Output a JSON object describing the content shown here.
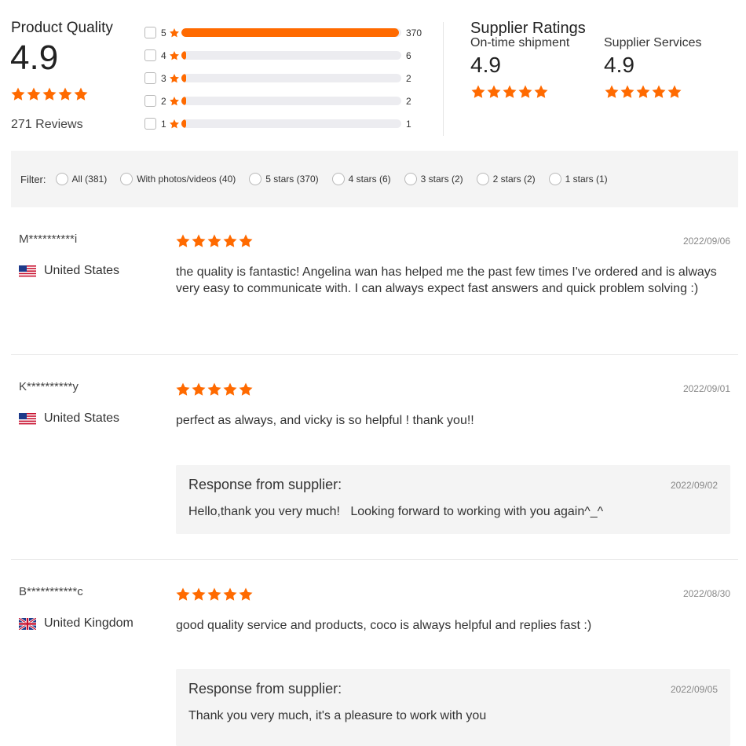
{
  "product_quality": {
    "title": "Product Quality",
    "score": "4.9",
    "stars": 5,
    "reviews_label": "271 Reviews"
  },
  "distribution": [
    {
      "stars": "5",
      "count": "370",
      "fill": 0.99
    },
    {
      "stars": "4",
      "count": "6",
      "fill": 0.02
    },
    {
      "stars": "3",
      "count": "2",
      "fill": 0.01
    },
    {
      "stars": "2",
      "count": "2",
      "fill": 0.01
    },
    {
      "stars": "1",
      "count": "1",
      "fill": 0.01
    }
  ],
  "supplier_ratings": {
    "title": "Supplier Ratings",
    "items": [
      {
        "label": "On-time shipment",
        "score": "4.9",
        "stars": 5
      },
      {
        "label": "Supplier Services",
        "score": "4.9",
        "stars": 5
      }
    ]
  },
  "filter": {
    "label": "Filter:",
    "options": [
      "All (381)",
      "With photos/videos (40)",
      "5 stars (370)",
      "4 stars (6)",
      "3 stars (2)",
      "2 stars (2)",
      "1 stars (1)"
    ]
  },
  "reviews": [
    {
      "user": "M**********i",
      "country": "United States",
      "flag": "us-flag-icon",
      "stars": 5,
      "date": "2022/09/06",
      "text": "the quality is fantastic! Angelina wan has helped me the past few times I've ordered and is always very easy to communicate with. I can always expect fast answers and quick problem solving :)"
    },
    {
      "user": "K**********y",
      "country": "United States",
      "flag": "us-flag-icon",
      "stars": 5,
      "date": "2022/09/01",
      "text": "perfect as always, and vicky is so helpful ! thank you!!",
      "response": {
        "title": "Response from supplier:",
        "date": "2022/09/02",
        "text": "Hello,thank you very much!   Looking forward to working with you again^_^"
      }
    },
    {
      "user": "B***********c",
      "country": "United Kingdom",
      "flag": "uk-flag-icon",
      "stars": 5,
      "date": "2022/08/30",
      "text": "good quality service and products, coco is always helpful and replies fast :)",
      "response": {
        "title": "Response from supplier:",
        "date": "2022/09/05",
        "text": "Thank you very much, it's a pleasure to work with you"
      }
    }
  ],
  "colors": {
    "accent": "#ff6a00",
    "track": "#ececf0",
    "panel": "#f4f4f4"
  }
}
